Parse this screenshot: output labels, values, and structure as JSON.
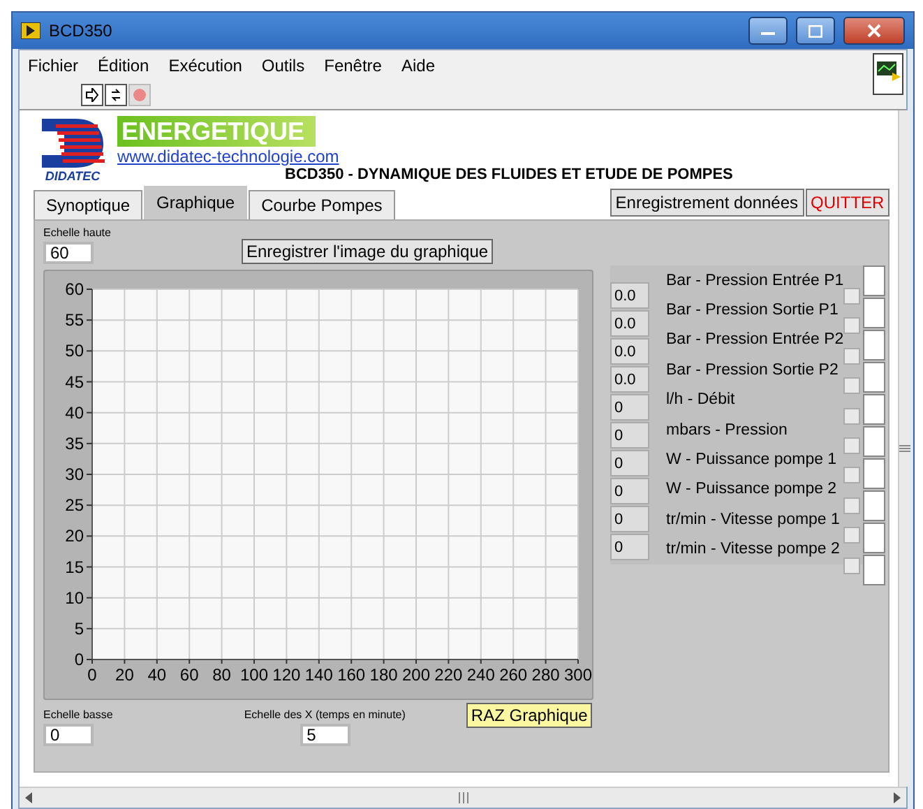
{
  "window": {
    "title": "BCD350"
  },
  "menu": [
    {
      "label": "Fichier"
    },
    {
      "label": "Édition"
    },
    {
      "label": "Exécution"
    },
    {
      "label": "Outils"
    },
    {
      "label": "Fenêtre"
    },
    {
      "label": "Aide"
    }
  ],
  "header": {
    "brand": "DIDATEC",
    "banner": "ENERGETIQUE",
    "link": "www.didatec-technologie.com",
    "title": "BCD350 - DYNAMIQUE DES FLUIDES ET ETUDE DE POMPES"
  },
  "tabs": [
    {
      "label": "Synoptique",
      "selected": false
    },
    {
      "label": "Graphique",
      "selected": true
    },
    {
      "label": "Courbe Pompes",
      "selected": false
    }
  ],
  "buttons": [
    {
      "label": "Enregistrement données",
      "kind": "normal"
    },
    {
      "label": "QUITTER",
      "kind": "danger"
    }
  ],
  "graph": {
    "top_scale": {
      "label": "Echelle haute",
      "value": "60"
    },
    "save_button": "Enregistrer l'image du graphique",
    "bottom_scale": {
      "label": "Echelle basse",
      "value": "0"
    },
    "x_scale": {
      "label": "Echelle des X (temps en minute)",
      "value": "5"
    },
    "reset_button": "RAZ Graphique",
    "chart_data": {
      "type": "line",
      "grid": true,
      "xlim": [
        0,
        300
      ],
      "ylim": [
        0,
        60
      ],
      "xticks": [
        0,
        20,
        40,
        60,
        80,
        100,
        120,
        140,
        160,
        180,
        200,
        220,
        240,
        260,
        280,
        300
      ],
      "yticks": [
        0,
        5,
        10,
        15,
        20,
        25,
        30,
        35,
        40,
        45,
        50,
        55,
        60
      ]
    }
  },
  "channels": [
    {
      "name": "Bar - Pression Entrée P1",
      "value": "0.0",
      "checked": false
    },
    {
      "name": "Bar - Pression Sortie P1",
      "value": "0.0",
      "checked": false
    },
    {
      "name": "Bar - Pression Entrée P2",
      "value": "0.0",
      "checked": false
    },
    {
      "name": "Bar - Pression Sortie P2",
      "value": "0.0",
      "checked": false
    },
    {
      "name": "l/h - Débit",
      "value": "0",
      "checked": false
    },
    {
      "name": "mbars - Pression",
      "value": "0",
      "checked": false
    },
    {
      "name": "W - Puissance pompe 1",
      "value": "0",
      "checked": false
    },
    {
      "name": "W - Puissance pompe 2",
      "value": "0",
      "checked": false
    },
    {
      "name": "tr/min - Vitesse pompe 1",
      "value": "0",
      "checked": false
    },
    {
      "name": "tr/min - Vitesse pompe 2",
      "value": "0",
      "checked": false
    }
  ]
}
